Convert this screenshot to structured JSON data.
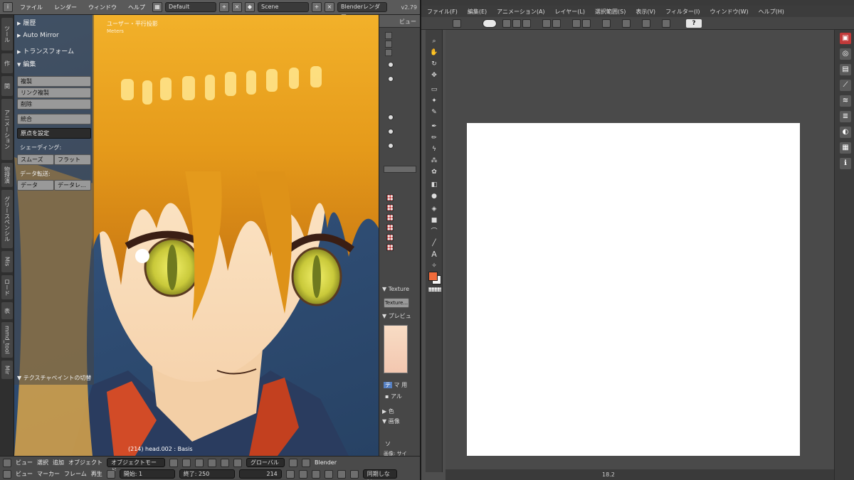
{
  "blender": {
    "topbar": {
      "menu": [
        "ファイル",
        "レンダー",
        "ウィンドウ",
        "ヘルプ"
      ],
      "screen_layout": "Default",
      "scene": "Scene",
      "render_engine": "Blenderレンダー",
      "version": "v2.79"
    },
    "left_tabs": [
      "ツール",
      "作",
      "関",
      "アニメーション",
      "物理演",
      "グリースペンシル",
      "Mis",
      "ロード",
      "表",
      "mmd_tool",
      "Mir"
    ],
    "viewport": {
      "view_label": "ユーザー・平行投影",
      "units_label": "Meters",
      "status": "(214) head.002 : Basis"
    },
    "tool_panel": {
      "history": "履歴",
      "auto_mirror": "Auto Mirror",
      "transform": "トランスフォーム",
      "edit": "編集",
      "duplicate": "複製",
      "duplicate_linked": "リンク複製",
      "delete": "削除",
      "join": "統合",
      "set_origin": "原点を設定",
      "shading_label": "シェーディング:",
      "smooth": "スムーズ",
      "flat": "フラット",
      "data_transfer_label": "データ転送:",
      "data": "データ",
      "data_layout": "データレ...",
      "texpaint_toggle": "テクスチャペイントの切替"
    },
    "right_strip": {
      "view": "ビュー",
      "texture_panel": "Texture",
      "texture_button": "Texture...",
      "preview_panel": "プレビュ",
      "tab_te": "テ",
      "tab_ma": "マ",
      "tab_yo": "用",
      "alpha": "アル",
      "color": "色",
      "image": "画像",
      "so": "ソ",
      "image_source": "画像: サイ"
    },
    "bottombar": {
      "row1": {
        "menu": [
          "ビュー",
          "選択",
          "追加",
          "オブジェクト"
        ],
        "mode": "オブジェクトモード",
        "orientation": "グローバル",
        "render_mode": "Blender"
      },
      "row2": {
        "menu": [
          "ビュー",
          "マーカー",
          "フレーム",
          "再生"
        ],
        "start_label": "開始:",
        "start": "1",
        "end_label": "終了:",
        "end": "250",
        "current": "214",
        "sync": "同期しない"
      }
    }
  },
  "clip": {
    "menu": [
      "ファイル(F)",
      "編集(E)",
      "アニメーション(A)",
      "レイヤー(L)",
      "選択範囲(S)",
      "表示(V)",
      "フィルター(I)",
      "ウィンドウ(W)",
      "ヘルプ(H)"
    ],
    "help_button": "?",
    "tools": [
      "magnifier-icon",
      "hand-icon",
      "rotate-icon",
      "move-icon",
      "select-rect-icon",
      "auto-select-icon",
      "eyedropper-icon",
      "pen-icon",
      "pencil-icon",
      "brush-icon",
      "airbrush-icon",
      "decoration-icon",
      "eraser-icon",
      "blend-icon",
      "fill-icon",
      "gradient-icon",
      "figure-icon",
      "ruler-icon",
      "text-icon",
      "balloon-icon"
    ],
    "text_tool_glyph": "A",
    "colors": {
      "main": "#f26b3a",
      "sub": "#f4f4f4",
      "canvas": "#ffffff"
    },
    "statusbar": {
      "zoom": "18.2"
    },
    "dock": [
      "palette-icon",
      "navigator-icon",
      "layer-icon",
      "brush-size-icon",
      "tool-property-icon",
      "subtool-icon",
      "color-wheel-icon",
      "material-icon",
      "info-icon"
    ]
  }
}
